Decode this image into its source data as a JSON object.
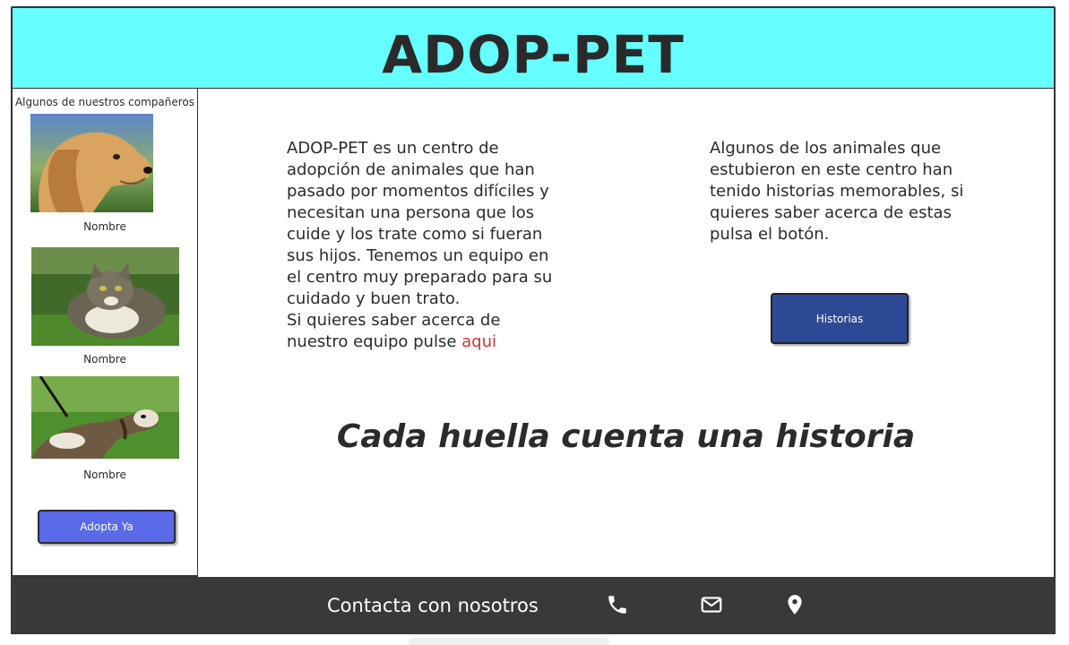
{
  "header": {
    "title": "ADOP-PET",
    "bg_color": "#66ffff"
  },
  "sidebar": {
    "title": "Algunos de nuestros compañeros",
    "pets": [
      {
        "image": "dog-photo",
        "name": "Nombre"
      },
      {
        "image": "cat-photo",
        "name": "Nombre"
      },
      {
        "image": "ferret-photo",
        "name": "Nombre"
      }
    ],
    "adopt_button": "Adopta Ya",
    "adopt_button_color": "#5b6ae8"
  },
  "main": {
    "about_text": "ADOP-PET es un centro de adopción de animales que han pasado por momentos difíciles y necesitan una persona que los cuide y los trate como si fueran sus hijos. Tenemos un equipo en el centro muy preparado para su cuidado y buen trato.",
    "team_text": "Si quieres saber acerca de nuestro equipo pulse",
    "team_link": "aqui",
    "link_color": "#d0342c",
    "stories_text": "Algunos de los animales que estubieron en este centro han tenido historias memorables, si quieres saber acerca de estas pulsa el botón.",
    "stories_button": "Historias",
    "stories_button_color": "#2e4a96",
    "slogan": "Cada huella cuenta una historia"
  },
  "footer": {
    "contact_label": "Contacta con nosotros",
    "icons": [
      "phone-icon",
      "mail-icon",
      "location-icon"
    ],
    "bg_color": "#393939"
  }
}
